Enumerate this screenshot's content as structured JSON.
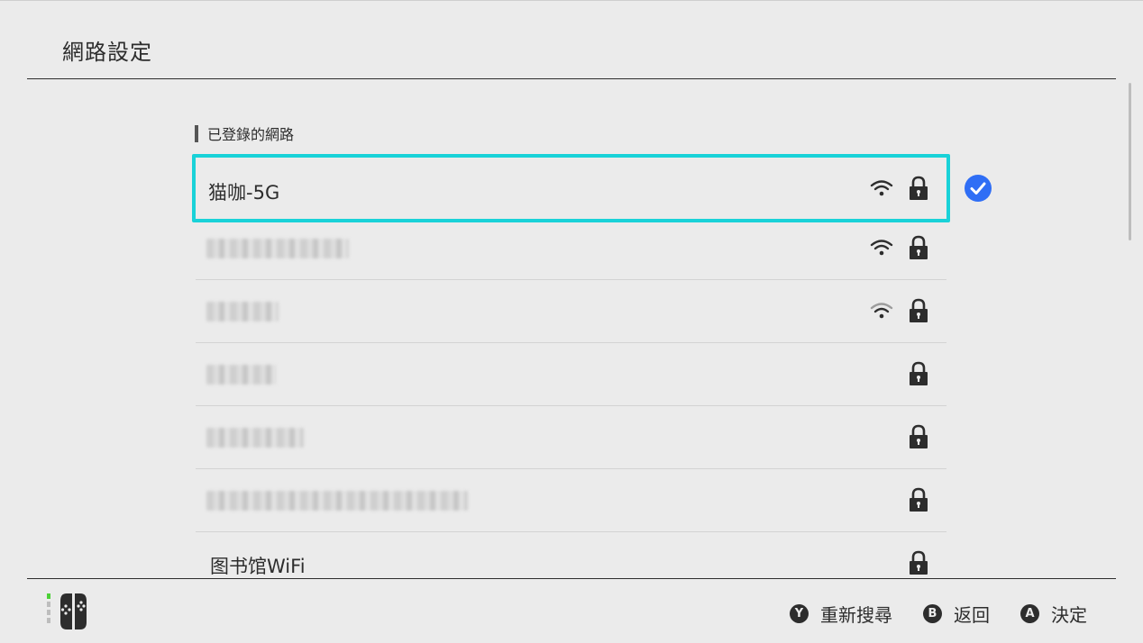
{
  "header": {
    "title": "網路設定"
  },
  "section": {
    "label": "已登錄的網路"
  },
  "networks": [
    {
      "name": "猫咖-5G",
      "obscured": false,
      "wifi": "strong",
      "locked": true,
      "selected": true,
      "connected": true
    },
    {
      "name": "",
      "obscured": true,
      "wifi": "strong",
      "locked": true,
      "selected": false
    },
    {
      "name": "",
      "obscured": true,
      "wifi": "weak",
      "locked": true,
      "selected": false
    },
    {
      "name": "",
      "obscured": true,
      "wifi": "none",
      "locked": true,
      "selected": false
    },
    {
      "name": "",
      "obscured": true,
      "wifi": "none",
      "locked": true,
      "selected": false
    },
    {
      "name": "",
      "obscured": true,
      "wifi": "none",
      "locked": true,
      "selected": false
    },
    {
      "name": "图书馆WiFi",
      "obscured": false,
      "wifi": "none",
      "locked": true,
      "selected": false
    }
  ],
  "footer": {
    "actions": [
      {
        "button": "Y",
        "label": "重新搜尋"
      },
      {
        "button": "B",
        "label": "返回"
      },
      {
        "button": "A",
        "label": "決定"
      }
    ]
  },
  "colors": {
    "focus": "#19d2d8",
    "connected": "#2f6ef5",
    "background": "#ebebeb",
    "text": "#2d2d2d"
  }
}
